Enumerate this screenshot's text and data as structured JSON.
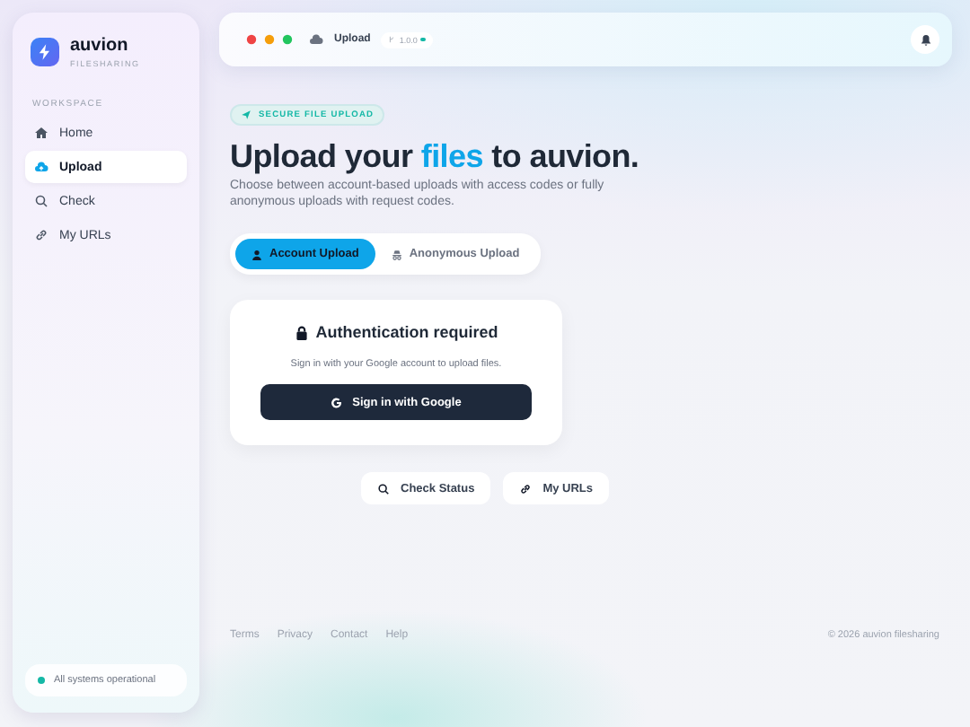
{
  "brand": {
    "name": "auvion",
    "tagline": "FILESHARING"
  },
  "sidebar": {
    "section": "WORKSPACE",
    "items": [
      {
        "label": "Home",
        "selected": false
      },
      {
        "label": "Upload",
        "selected": true
      },
      {
        "label": "Check",
        "selected": false
      },
      {
        "label": "My URLs",
        "selected": false
      }
    ],
    "status": {
      "text": "All systems operational",
      "color": "#14b8a6"
    }
  },
  "topbar": {
    "page": "Upload",
    "version": "1.0.0"
  },
  "hero": {
    "badge": "SECURE FILE UPLOAD",
    "title_before": "Upload your ",
    "title_highlight": "files",
    "title_after": " to auvion.",
    "subtitle": "Choose between account-based uploads with access codes or fully anonymous uploads with request codes."
  },
  "tabs": [
    {
      "label": "Account Upload",
      "selected": true
    },
    {
      "label": "Anonymous Upload",
      "selected": false
    }
  ],
  "auth_card": {
    "title": "Authentication required",
    "text": "Sign in with your Google account to upload files.",
    "button": "Sign in with Google"
  },
  "actions": [
    {
      "label": "Check Status"
    },
    {
      "label": "My URLs"
    }
  ],
  "footer": {
    "links": [
      "Terms",
      "Privacy",
      "Contact",
      "Help"
    ],
    "copyright": "© 2026 auvion filesharing"
  }
}
